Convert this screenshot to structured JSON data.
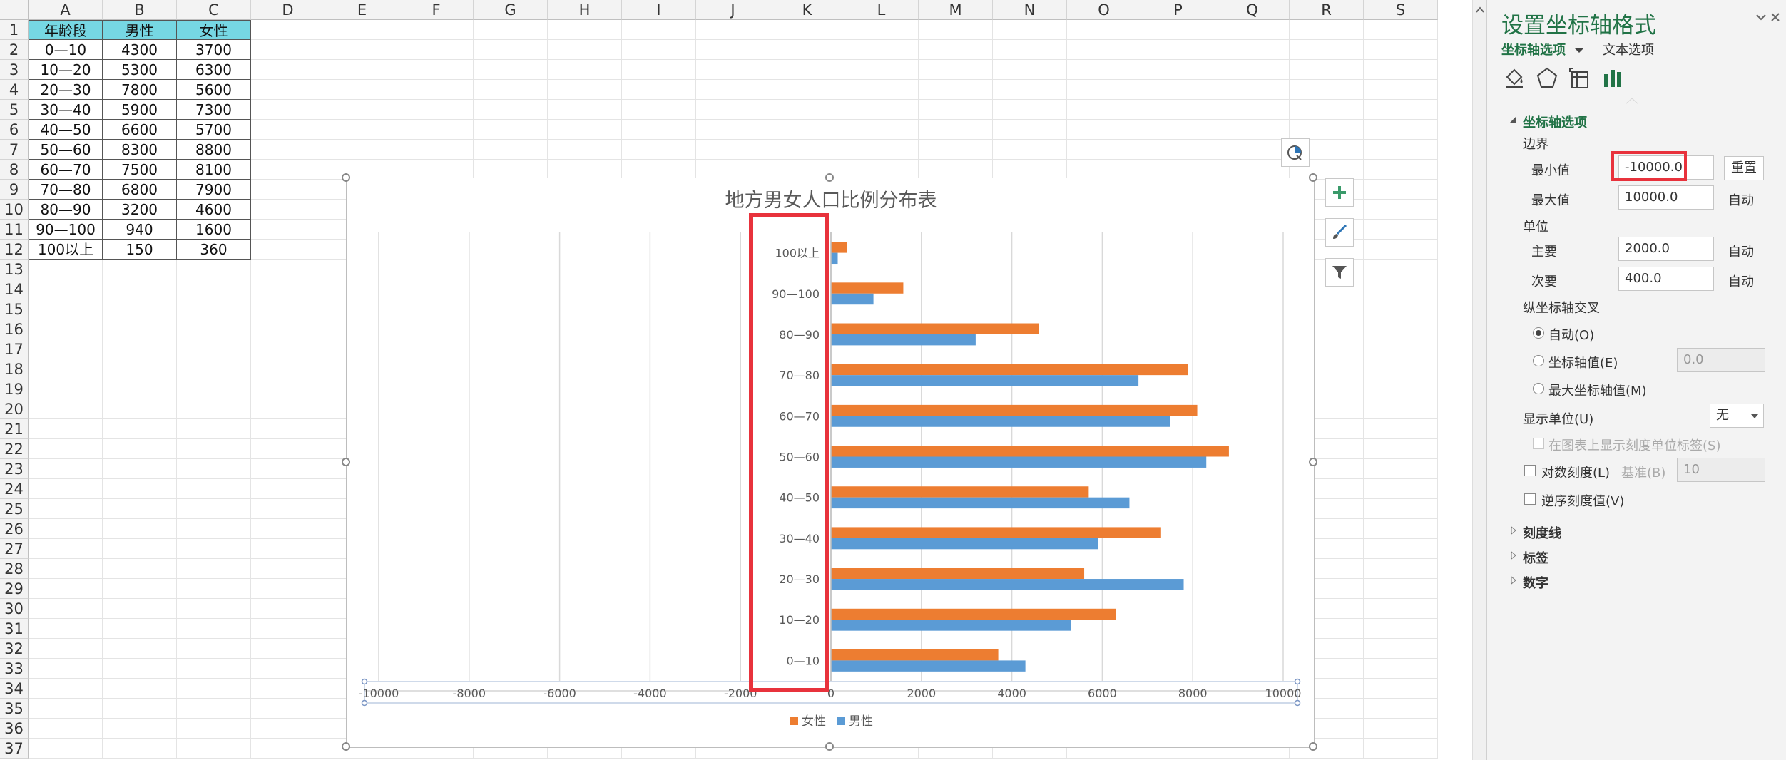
{
  "sheet": {
    "columns": [
      "A",
      "B",
      "C",
      "D",
      "E",
      "F",
      "G",
      "H",
      "I",
      "J",
      "K",
      "L",
      "M",
      "N",
      "O",
      "P",
      "Q",
      "R",
      "S"
    ],
    "rows": [
      "1",
      "2",
      "3",
      "4",
      "5",
      "6",
      "7",
      "8",
      "9",
      "10",
      "11",
      "12",
      "13",
      "14",
      "15",
      "16",
      "17",
      "18",
      "19",
      "20",
      "21",
      "22",
      "23",
      "24",
      "25",
      "26",
      "27",
      "28",
      "29",
      "30",
      "31",
      "32",
      "33",
      "34",
      "35",
      "36",
      "37"
    ],
    "table_header": [
      "年龄段",
      "男性",
      "女性"
    ],
    "table_rows": [
      [
        "0—10",
        "4300",
        "3700"
      ],
      [
        "10—20",
        "5300",
        "6300"
      ],
      [
        "20—30",
        "7800",
        "5600"
      ],
      [
        "30—40",
        "5900",
        "7300"
      ],
      [
        "40—50",
        "6600",
        "5700"
      ],
      [
        "50—60",
        "8300",
        "8800"
      ],
      [
        "60—70",
        "7500",
        "8100"
      ],
      [
        "70—80",
        "6800",
        "7900"
      ],
      [
        "80—90",
        "3200",
        "4600"
      ],
      [
        "90—100",
        "940",
        "1600"
      ],
      [
        "100以上",
        "150",
        "360"
      ]
    ]
  },
  "chart_data": {
    "type": "bar",
    "orientation": "horizontal",
    "title": "地方男女人口比例分布表",
    "categories": [
      "0—10",
      "10—20",
      "20—30",
      "30—40",
      "40—50",
      "50—60",
      "60—70",
      "70—80",
      "80—90",
      "90—100",
      "100以上"
    ],
    "series": [
      {
        "name": "女性",
        "color": "#ed7d31",
        "values": [
          3700,
          6300,
          5600,
          7300,
          5700,
          8800,
          8100,
          7900,
          4600,
          1600,
          360
        ]
      },
      {
        "name": "男性",
        "color": "#5b9bd5",
        "values": [
          4300,
          5300,
          7800,
          5900,
          6600,
          8300,
          7500,
          6800,
          3200,
          940,
          150
        ]
      }
    ],
    "xlim": [
      -10000,
      10000
    ],
    "xticks": [
      "-10000",
      "-8000",
      "-6000",
      "-4000",
      "-2000",
      "0",
      "2000",
      "4000",
      "6000",
      "8000",
      "10000"
    ],
    "grid": true,
    "legend": "bottom"
  },
  "panel": {
    "title": "设置坐标轴格式",
    "tab_axis": "坐标轴选项",
    "tab_text": "文本选项",
    "section_axis": "坐标轴选项",
    "bounds": "边界",
    "min_label": "最小值",
    "min_value": "-10000.0",
    "reset": "重置",
    "max_label": "最大值",
    "max_value": "10000.0",
    "auto": "自动",
    "units": "单位",
    "major_label": "主要",
    "major_value": "2000.0",
    "minor_label": "次要",
    "minor_value": "400.0",
    "cross": "纵坐标轴交叉",
    "radio_auto": "自动(O)",
    "radio_axis_value": "坐标轴值(E)",
    "axis_value_box": "0.0",
    "radio_max": "最大坐标轴值(M)",
    "display_units": "显示单位(U)",
    "display_units_value": "无",
    "show_units_label": "在图表上显示刻度单位标签(S)",
    "log_scale": "对数刻度(L)",
    "base_label": "基准(B)",
    "base_value": "10",
    "reverse": "逆序刻度值(V)",
    "tick_marks": "刻度线",
    "labels": "标签",
    "number": "数字",
    "accent_color": "#217346",
    "highlight_color": "#e8323c"
  }
}
